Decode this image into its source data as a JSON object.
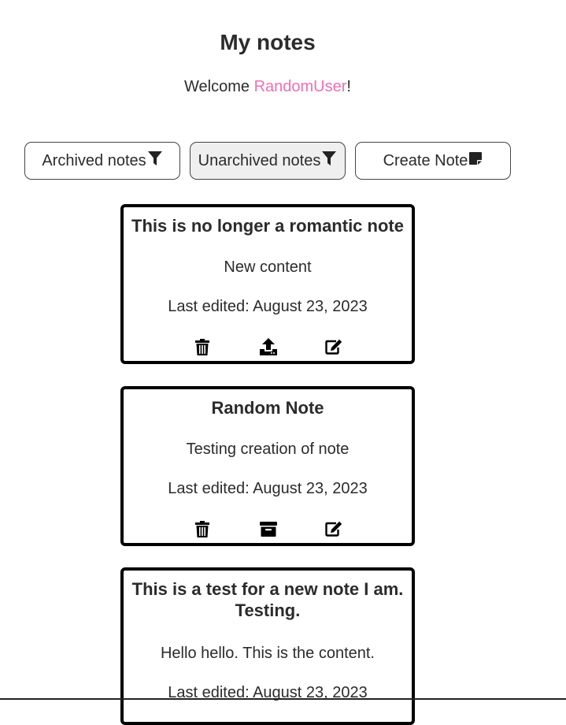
{
  "header": {
    "title": "My notes",
    "welcome_prefix": "Welcome ",
    "username": "RandomUser",
    "welcome_suffix": "!"
  },
  "filters": {
    "archived_label": "Archived notes",
    "unarchived_label": "Unarchived notes",
    "create_label": "Create Note",
    "active": "unarchived"
  },
  "colors": {
    "username": "#f06fb4",
    "border": "#000000",
    "active_button_bg": "#efefef"
  },
  "notes": [
    {
      "title": "This is no longer a romantic note",
      "content": "New content",
      "edited": "Last edited: August 23, 2023",
      "actions": [
        "trash-icon",
        "unarchive-icon",
        "edit-icon"
      ]
    },
    {
      "title": "Random Note",
      "content": "Testing creation of note",
      "edited": "Last edited: August 23, 2023",
      "actions": [
        "trash-icon",
        "archive-icon",
        "edit-icon"
      ]
    },
    {
      "title": "This is a test for a new note I am. Testing.",
      "content": "Hello hello. This is the content.",
      "edited": "Last edited: August 23, 2023",
      "actions": []
    }
  ]
}
